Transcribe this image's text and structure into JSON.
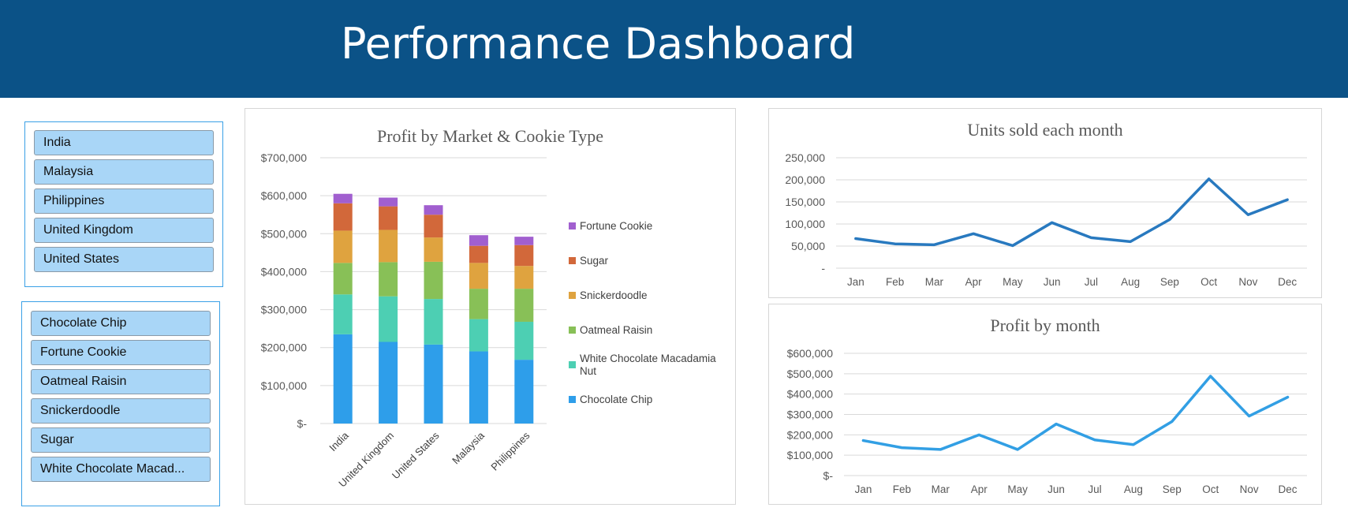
{
  "header": {
    "title": "Performance Dashboard"
  },
  "market_slicer": {
    "items": [
      "India",
      "Malaysia",
      "Philippines",
      "United Kingdom",
      "United States"
    ]
  },
  "cookie_slicer": {
    "items": [
      "Chocolate Chip",
      "Fortune Cookie",
      "Oatmeal Raisin",
      "Snickerdoodle",
      "Sugar",
      "White Chocolate Macad..."
    ]
  },
  "chart_data": [
    {
      "type": "bar",
      "stacked": true,
      "title": "Profit by Market & Cookie Type",
      "categories": [
        "India",
        "United Kingdom",
        "United States",
        "Malaysia",
        "Philippines"
      ],
      "ylim": [
        0,
        700000
      ],
      "yticks": [
        "$-",
        "$100,000",
        "$200,000",
        "$300,000",
        "$400,000",
        "$500,000",
        "$600,000",
        "$700,000"
      ],
      "legend_position": "right",
      "series": [
        {
          "name": "Chocolate Chip",
          "color": "#2e9eea",
          "values": [
            235000,
            215000,
            208000,
            190000,
            168000
          ]
        },
        {
          "name": "White Chocolate Macadamia Nut",
          "color": "#4dcfb3",
          "values": [
            105000,
            120000,
            120000,
            85000,
            100000
          ]
        },
        {
          "name": "Oatmeal Raisin",
          "color": "#88c057",
          "values": [
            83000,
            90000,
            98000,
            80000,
            87000
          ]
        },
        {
          "name": "Snickerdoodle",
          "color": "#dfa33f",
          "values": [
            85000,
            85000,
            64000,
            68000,
            60000
          ]
        },
        {
          "name": "Sugar",
          "color": "#d2683a",
          "values": [
            72000,
            62000,
            60000,
            45000,
            55000
          ]
        },
        {
          "name": "Fortune Cookie",
          "color": "#a15fcf",
          "values": [
            25000,
            23000,
            25000,
            28000,
            22000
          ]
        }
      ]
    },
    {
      "type": "line",
      "title": "Units sold each month",
      "categories": [
        "Jan",
        "Feb",
        "Mar",
        "Apr",
        "May",
        "Jun",
        "Jul",
        "Aug",
        "Sep",
        "Oct",
        "Nov",
        "Dec"
      ],
      "ylim": [
        0,
        250000
      ],
      "yticks": [
        "-",
        "50,000",
        "100,000",
        "150,000",
        "200,000",
        "250,000"
      ],
      "series": [
        {
          "color": "#2879bf",
          "values": [
            67000,
            55000,
            53000,
            78000,
            51000,
            103000,
            69000,
            60000,
            110000,
            202000,
            121000,
            155000
          ]
        }
      ]
    },
    {
      "type": "line",
      "title": "Profit by month",
      "categories": [
        "Jan",
        "Feb",
        "Mar",
        "Apr",
        "May",
        "Jun",
        "Jul",
        "Aug",
        "Sep",
        "Oct",
        "Nov",
        "Dec"
      ],
      "ylim": [
        0,
        600000
      ],
      "yticks": [
        "$-",
        "$100,000",
        "$200,000",
        "$300,000",
        "$400,000",
        "$500,000",
        "$600,000"
      ],
      "series": [
        {
          "color": "#329fe4",
          "values": [
            172000,
            137000,
            128000,
            200000,
            128000,
            253000,
            175000,
            152000,
            265000,
            488000,
            292000,
            385000
          ]
        }
      ]
    }
  ]
}
